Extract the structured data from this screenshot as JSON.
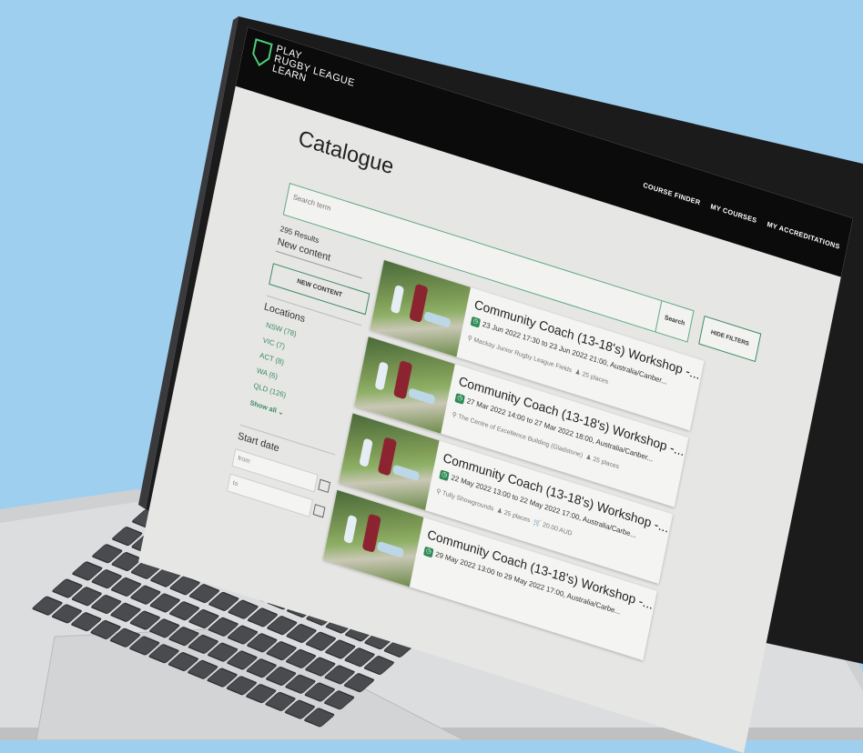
{
  "brand": {
    "line1": "PLAY",
    "line2": "RUGBY LEAGUE",
    "line3": "LEARN"
  },
  "nav": [
    {
      "label": "COURSE FINDER"
    },
    {
      "label": "MY COURSES"
    },
    {
      "label": "MY ACCREDITATIONS"
    }
  ],
  "page": {
    "title": "Catalogue"
  },
  "search": {
    "placeholder": "Search term",
    "button_label": "Search",
    "hide_filters_label": "HIDE FILTERS"
  },
  "results": {
    "count_label": "295 Results"
  },
  "new_content": {
    "heading": "New content",
    "button_label": "NEW CONTENT"
  },
  "filters": {
    "locations_heading": "Locations",
    "locations": [
      {
        "label": "NSW (78)"
      },
      {
        "label": "VIC (7)"
      },
      {
        "label": "ACT (8)"
      },
      {
        "label": "WA (6)"
      },
      {
        "label": "QLD (126)"
      }
    ],
    "show_all_label": "Show all",
    "start_date_heading": "Start date",
    "from_placeholder": "from",
    "to_placeholder": "to"
  },
  "courses": [
    {
      "title": "Community Coach (13-18's) Workshop -...",
      "date": "23 Jun 2022 17:30 to 23 Jun 2022 21:00, Australia/Canber...",
      "venue": "Mackay Junior Rugby League Fields",
      "places": "25 places",
      "price": ""
    },
    {
      "title": "Community Coach (13-18's) Workshop -...",
      "date": "27 Mar 2022 14:00 to 27 Mar 2022 18:00, Australia/Canber...",
      "venue": "The Centre of Excellence Building (Gladstone)",
      "places": "25 places",
      "price": ""
    },
    {
      "title": "Community Coach (13-18's) Workshop -...",
      "date": "22 May 2022 13:00 to 22 May 2022 17:00, Australia/Carbe...",
      "venue": "Tully Showgrounds",
      "places": "25 places",
      "price": "20.00 AUD"
    },
    {
      "title": "Community Coach (13-18's) Workshop -...",
      "date": "29 May 2022 13:00 to 29 May 2022 17:00, Australia/Carbe...",
      "venue": "",
      "places": "",
      "price": ""
    }
  ],
  "colors": {
    "background": "#9fcfee",
    "topbar": "#0b0b0b",
    "accent_green": "#3d8a63",
    "screen_bg": "#e6e6e4",
    "laptop_silver": "#d9d9d9"
  }
}
